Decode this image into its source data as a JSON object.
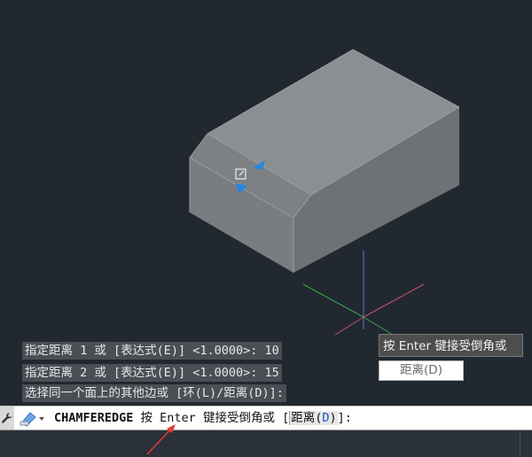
{
  "history": {
    "line1": "指定距离 1 或 [表达式(E)] <1.0000>: 10",
    "line2": "指定距离 2 或 [表达式(E)] <1.0000>: 15",
    "line3": "选择同一个面上的其他边或 [环(L)/距离(D)]:"
  },
  "tooltip": {
    "hint": "按 Enter 键接受倒角或",
    "option": "距离(D)"
  },
  "command": {
    "name": "CHAMFEREDGE",
    "prompt_before": " 按 ",
    "enter_word": "Enter",
    "prompt_after": " 键接受倒角或 [",
    "option_text": "距离(",
    "option_key": "D",
    "option_close": ")",
    "tail": "]:"
  },
  "colors": {
    "background": "#212830",
    "command_line": "#ffffff",
    "option_key": "#1a56c8",
    "grip_arrow": "#1e88e5",
    "annotation_arrow": "#e53935"
  },
  "icons": {
    "wrench": "wrench-icon",
    "recent": "recent-commands-icon",
    "grip": "grip-icon",
    "ucs": "ucs-axes-icon"
  }
}
